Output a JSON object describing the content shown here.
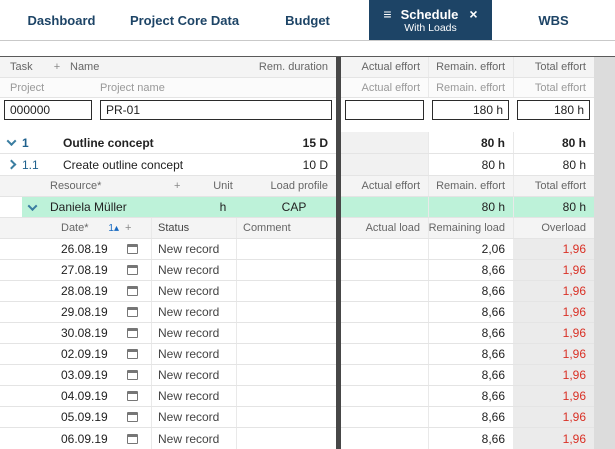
{
  "tabbar": {
    "tabs": [
      {
        "label": "Dashboard"
      },
      {
        "label": "Project Core Data"
      },
      {
        "label": "Budget"
      },
      {
        "label": "Schedule",
        "sublabel": "With Loads"
      },
      {
        "label": "WBS"
      }
    ]
  },
  "icons": {
    "menu": "≡",
    "close": "×",
    "sort_asc": "▴",
    "add": "+"
  },
  "headers": {
    "task": {
      "task": "Task",
      "name": "Name",
      "rem_duration": "Rem. duration",
      "actual": "Actual effort",
      "remain": "Remain. effort",
      "total": "Total effort"
    },
    "project": {
      "project": "Project",
      "name": "Project name",
      "actual": "Actual effort",
      "remain": "Remain. effort",
      "total": "Total effort"
    },
    "resource": {
      "resource": "Resource*",
      "unit": "Unit",
      "load_profile": "Load profile",
      "actual": "Actual effort",
      "remain": "Remain. effort",
      "total": "Total effort"
    },
    "load": {
      "date": "Date*",
      "sort": "1",
      "status": "Status",
      "comment": "Comment",
      "actual": "Actual load",
      "remaining": "Remaining load",
      "overload": "Overload"
    }
  },
  "project_row": {
    "id": "000000",
    "name": "PR-01",
    "actual": "",
    "remain": "180 h",
    "total": "180 h"
  },
  "tasks": [
    {
      "number": "1",
      "name": "Outline concept",
      "rem_duration": "15 D",
      "actual": "",
      "remain": "80 h",
      "total": "80 h"
    },
    {
      "number": "1.1",
      "name": "Create outline concept",
      "rem_duration": "10 D",
      "actual": "",
      "remain": "80 h",
      "total": "80 h"
    }
  ],
  "resource_row": {
    "name": "Daniela Müller",
    "unit": "h",
    "load_profile": "CAP",
    "actual": "",
    "remain": "80 h",
    "total": "80 h"
  },
  "load_rows": [
    {
      "date": "26.08.19",
      "status": "New record",
      "comment": "",
      "actual": "",
      "remaining": "2,06",
      "overload": "1,96"
    },
    {
      "date": "27.08.19",
      "status": "New record",
      "comment": "",
      "actual": "",
      "remaining": "8,66",
      "overload": "1,96"
    },
    {
      "date": "28.08.19",
      "status": "New record",
      "comment": "",
      "actual": "",
      "remaining": "8,66",
      "overload": "1,96"
    },
    {
      "date": "29.08.19",
      "status": "New record",
      "comment": "",
      "actual": "",
      "remaining": "8,66",
      "overload": "1,96"
    },
    {
      "date": "30.08.19",
      "status": "New record",
      "comment": "",
      "actual": "",
      "remaining": "8,66",
      "overload": "1,96"
    },
    {
      "date": "02.09.19",
      "status": "New record",
      "comment": "",
      "actual": "",
      "remaining": "8,66",
      "overload": "1,96"
    },
    {
      "date": "03.09.19",
      "status": "New record",
      "comment": "",
      "actual": "",
      "remaining": "8,66",
      "overload": "1,96"
    },
    {
      "date": "04.09.19",
      "status": "New record",
      "comment": "",
      "actual": "",
      "remaining": "8,66",
      "overload": "1,96"
    },
    {
      "date": "05.09.19",
      "status": "New record",
      "comment": "",
      "actual": "",
      "remaining": "8,66",
      "overload": "1,96"
    },
    {
      "date": "06.09.19",
      "status": "New record",
      "comment": "",
      "actual": "",
      "remaining": "8,66",
      "overload": "1,96"
    }
  ],
  "colors": {
    "active_tab": "#1d4466",
    "highlight_row": "#bdf2d9",
    "overload_text": "#d93025",
    "pane_divider": "#474747"
  }
}
